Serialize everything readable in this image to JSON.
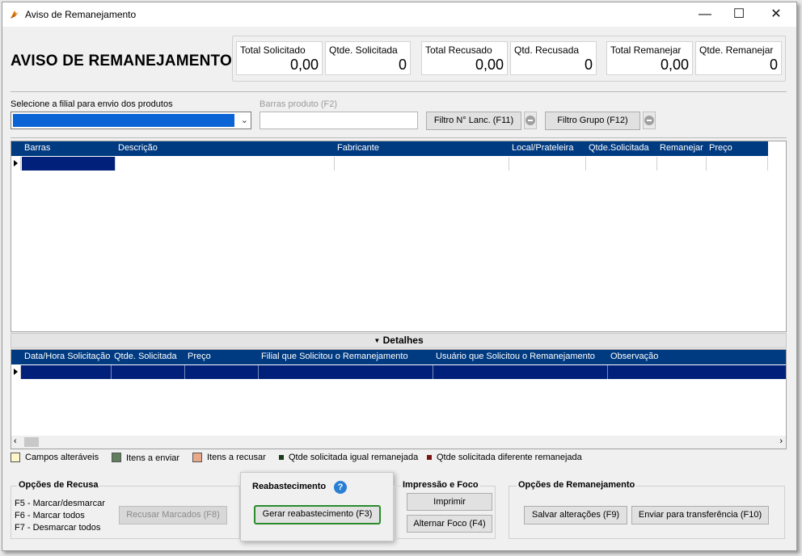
{
  "window": {
    "title": "Aviso de Remanejamento",
    "controls": {
      "minimize": "—",
      "maximize": "☐",
      "close": "✕"
    }
  },
  "page_heading": "AVISO DE REMANEJAMENTO",
  "totals": [
    {
      "label": "Total Solicitado",
      "value": "0,00"
    },
    {
      "label": "Qtde. Solicitada",
      "value": "0"
    },
    {
      "label": "Total Recusado",
      "value": "0,00"
    },
    {
      "label": "Qtd. Recusada",
      "value": "0"
    },
    {
      "label": "Total Remanejar",
      "value": "0,00"
    },
    {
      "label": "Qtde. Remanejar",
      "value": "0"
    }
  ],
  "filters": {
    "branch_label": "Selecione a filial para envio dos produtos",
    "branch_value": "",
    "barcode_label": "Barras produto (F2)",
    "barcode_value": "",
    "filter_lanc_button": "Filtro N° Lanc. (F11)",
    "filter_grupo_button": "Filtro Grupo (F12)"
  },
  "products_grid": {
    "columns": [
      "Barras",
      "Descrição",
      "Fabricante",
      "Local/Prateleira",
      "Qtde.Solicitada",
      "Remanejar",
      "Preço"
    ]
  },
  "details_bar": {
    "label": "Detalhes",
    "icon": "triangle-down-icon"
  },
  "details_grid": {
    "columns": [
      "Data/Hora Solicitação",
      "Qtde. Solicitada",
      "Preço",
      "Filial que Solicitou o Remanejamento",
      "Usuário que Solicitou o Remanejamento",
      "Observação"
    ]
  },
  "legend": [
    {
      "label": "Campos alteráveis",
      "color": "#fdf7c8"
    },
    {
      "label": "Itens a enviar",
      "color": "#5f7f5f"
    },
    {
      "label": "Itens a recusar",
      "color": "#e8a88a"
    },
    {
      "label": "Qtde solicitada igual remanejada",
      "color": "#1a3a1a"
    },
    {
      "label": "Qtde solicitada diferente remanejada",
      "color": "#7a1414"
    }
  ],
  "recusa_group": {
    "title": "Opções de Recusa",
    "shortcuts": [
      "F5 - Marcar/desmarcar",
      "F6 - Marcar todos",
      "F7 - Desmarcar todos"
    ],
    "refuse_button": "Recusar Marcados (F8)"
  },
  "reabastecimento_group": {
    "title": "Reabastecimento",
    "help_icon": "?",
    "generate_button": "Gerar reabastecimento (F3)"
  },
  "impressao_group": {
    "title": "Impressão e Foco",
    "print_button": "Imprimir",
    "focus_button": "Alternar Foco (F4)"
  },
  "remanejamento_group": {
    "title": "Opções de Remanejamento",
    "save_button": "Salvar alterações (F9)",
    "send_button": "Enviar para transferência (F10)"
  },
  "colors": {
    "grid_header": "#003a80",
    "selection": "#0a64d6",
    "highlight_border": "#2a8c2a"
  }
}
